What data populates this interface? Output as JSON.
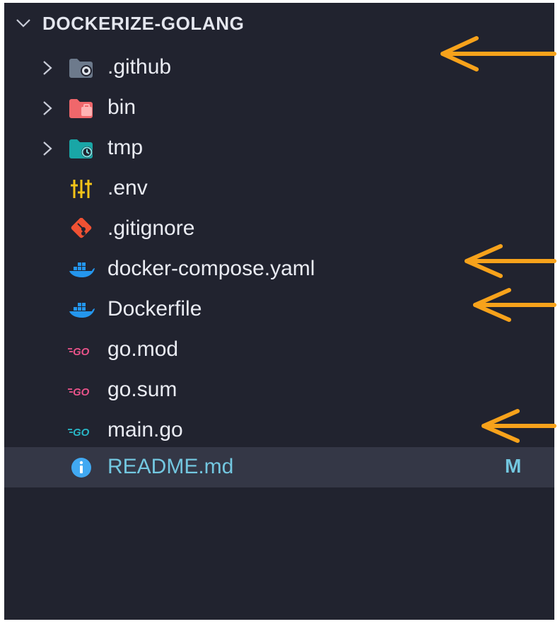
{
  "explorer": {
    "folder_name": "DOCKERIZE-GOLANG",
    "items": [
      {
        "label": ".github",
        "kind": "folder",
        "icon": "github-folder-icon",
        "expandable": true
      },
      {
        "label": "bin",
        "kind": "folder",
        "icon": "bin-folder-icon",
        "expandable": true
      },
      {
        "label": "tmp",
        "kind": "folder",
        "icon": "tmp-folder-icon",
        "expandable": true
      },
      {
        "label": ".env",
        "kind": "file",
        "icon": "env-settings-icon"
      },
      {
        "label": ".gitignore",
        "kind": "file",
        "icon": "git-icon"
      },
      {
        "label": "docker-compose.yaml",
        "kind": "file",
        "icon": "docker-icon"
      },
      {
        "label": "Dockerfile",
        "kind": "file",
        "icon": "docker-icon"
      },
      {
        "label": "go.mod",
        "kind": "file",
        "icon": "go-mod-icon"
      },
      {
        "label": "go.sum",
        "kind": "file",
        "icon": "go-sum-icon"
      },
      {
        "label": "main.go",
        "kind": "file",
        "icon": "go-file-icon"
      },
      {
        "label": "README.md",
        "kind": "file",
        "icon": "info-icon",
        "selected": true,
        "badge": "M"
      }
    ]
  },
  "colors": {
    "panel_bg": "#21232f",
    "selected_bg": "#343746",
    "accent_arrow": "#f7a21b",
    "modified_text": "#73c7e0"
  }
}
